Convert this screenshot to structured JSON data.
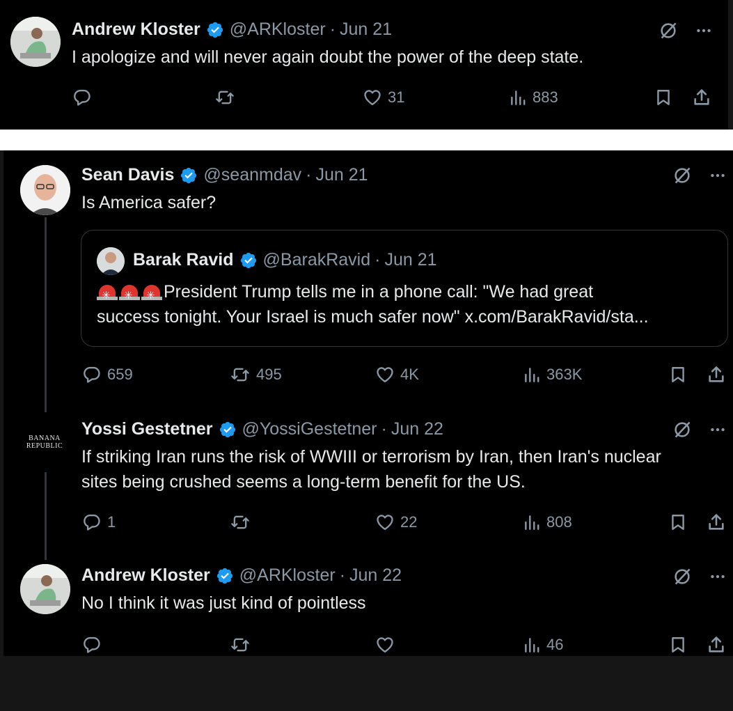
{
  "tweets": [
    {
      "name": "Andrew Kloster",
      "handle": "@ARKloster",
      "sep": "·",
      "date": "Jun 21",
      "text": "I apologize and will never again doubt the power of the deep state.",
      "stats": {
        "replies": "",
        "reposts": "",
        "likes": "31",
        "views": "883"
      }
    },
    {
      "name": "Sean Davis",
      "handle": "@seanmdav",
      "sep": "·",
      "date": "Jun 21",
      "text": "Is America safer?",
      "quote": {
        "name": "Barak Ravid",
        "handle": "@BarakRavid",
        "sep": "·",
        "date": "Jun 21",
        "text_line1": "President Trump tells me in a phone call: \"We had great",
        "text_line2": "success tonight. Your Israel is much safer now\" x.com/BarakRavid/sta..."
      },
      "stats": {
        "replies": "659",
        "reposts": "495",
        "likes": "4K",
        "views": "363K"
      }
    },
    {
      "name": "Yossi Gestetner",
      "handle": "@YossiGestetner",
      "sep": "·",
      "date": "Jun 22",
      "avatar_logo": {
        "line1": "BANANA",
        "line2": "REPUBLIC"
      },
      "text_line1": "If striking Iran runs the risk of WWIII or terrorism by Iran, then Iran's nuclear",
      "text_line2": "sites being crushed seems a long-term benefit for the US.",
      "stats": {
        "replies": "1",
        "reposts": "",
        "likes": "22",
        "views": "808"
      }
    },
    {
      "name": "Andrew Kloster",
      "handle": "@ARKloster",
      "sep": "·",
      "date": "Jun 22",
      "text": "No I think it was just kind of pointless",
      "stats": {
        "replies": "",
        "reposts": "",
        "likes": "",
        "views": "46"
      }
    }
  ],
  "icons": {
    "verified": "verified-badge-icon",
    "grok": "grok-icon",
    "more": "more-icon",
    "reply": "reply-icon",
    "repost": "repost-icon",
    "like": "like-icon",
    "views": "views-icon",
    "bookmark": "bookmark-icon",
    "share": "share-icon"
  },
  "colors": {
    "background": "#000000",
    "text": "#e7e9ea",
    "muted": "#8b98a5",
    "verified": "#1d9bf0",
    "border": "#333639"
  }
}
